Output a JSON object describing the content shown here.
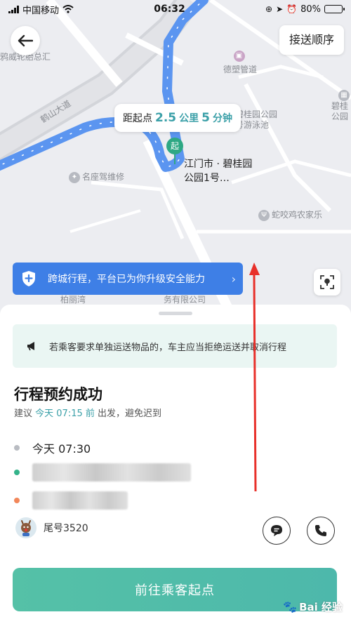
{
  "status_bar": {
    "carrier": "中国移动",
    "time": "06:32",
    "battery": "80%",
    "battery_level": 0.8
  },
  "map": {
    "back_icon": "back-arrow-icon",
    "order_button": "接送顺序",
    "labels": {
      "tire_shop": "鸦威轮胎总汇",
      "hesan_road": "鹤山大道",
      "desu_pipe": "德塑管道",
      "bigui_park_pool_1": "碧桂园公园",
      "bigui_park_pool_2": "号游泳池",
      "bigui_east_1": "碧桂",
      "bigui_east_2": "公园",
      "mingzuo": "名座驾维修",
      "snake_restaurant": "蛇咬鸡农家乐",
      "bailiwan": "柏丽湾",
      "company": "务有限公司"
    },
    "distance_bubble": {
      "prefix": "距起点",
      "distance": "2.5",
      "distance_unit": "公里",
      "minutes": "5",
      "minutes_unit": "分钟"
    },
    "start_pin": "起",
    "start_label": "江门市 · 碧桂园公园1号…",
    "safety_banner": "跨城行程，平台已为你升级安全能力"
  },
  "sheet": {
    "notice": "若乘客要求单独运送物品的，车主应当拒绝运送并取消行程",
    "title": "行程预约成功",
    "suggest": {
      "pre": "建议",
      "time": "今天 07:15 前",
      "post": "出发，避免迟到"
    },
    "departure_time": "今天 07:30",
    "driver": {
      "tail_number": "尾号3520"
    },
    "go_button": "前往乘客起点"
  },
  "watermark": "Bai 经验",
  "colors": {
    "accent": "#3ba0a8",
    "route": "#5b95f0",
    "banner": "#3e7fe6",
    "button": "#52bea9",
    "pin": "#2ea884"
  }
}
